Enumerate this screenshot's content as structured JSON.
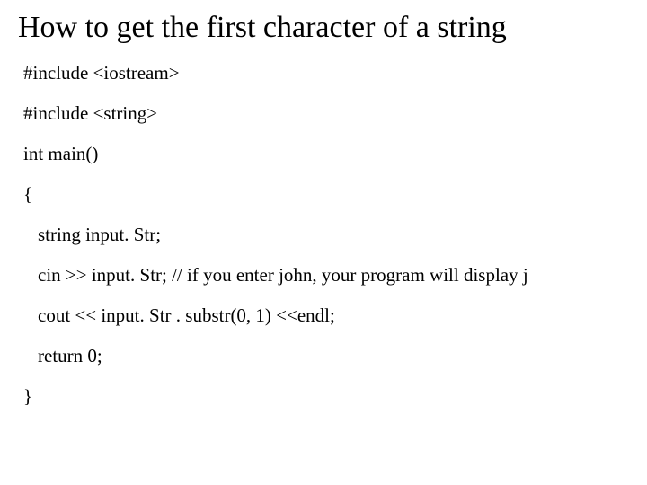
{
  "title": "How to get the first character of a string",
  "lines": {
    "l1": "#include <iostream>",
    "l2": "#include <string>",
    "l3": "int main()",
    "l4": "{",
    "l5": "string input. Str;",
    "l6": "cin >> input. Str;  // if you enter john, your program will display j",
    "l7": "cout << input. Str . substr(0, 1) <<endl;",
    "l8": "return 0;",
    "l9": "}"
  }
}
